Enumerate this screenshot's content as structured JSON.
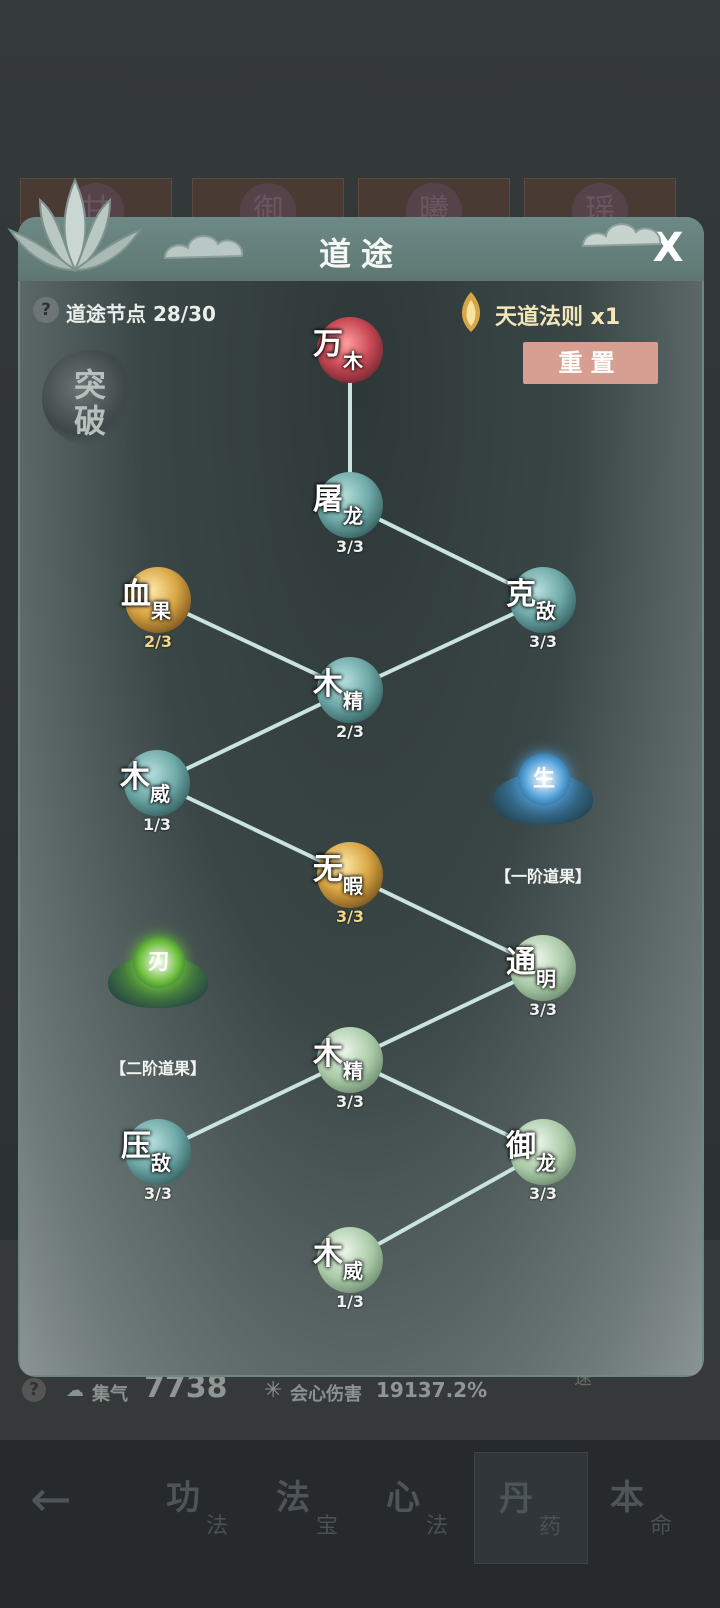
{
  "background": {
    "tiles": [
      "甘",
      "御",
      "曦",
      "瑶"
    ],
    "stats": {
      "qi_label": "集气",
      "qi_value": "7738",
      "crit_label": "会心伤害",
      "crit_value": "19137.2%",
      "side_badge": "速"
    }
  },
  "bottom_nav": [
    {
      "big": "功",
      "small": "法"
    },
    {
      "big": "法",
      "small": "宝"
    },
    {
      "big": "心",
      "small": "法"
    },
    {
      "big": "丹",
      "small": "药"
    },
    {
      "big": "本",
      "small": "命"
    }
  ],
  "modal": {
    "title": "道途",
    "close_label": "X",
    "path_nodes_label": "道途节点 28/30",
    "help_label": "?",
    "law_label": "天道法则 x1",
    "reset_label": "重置",
    "breakthrough": [
      "突",
      "破"
    ]
  },
  "nodes": [
    {
      "id": "wanmu",
      "c1": "万",
      "c2": "木",
      "level": "",
      "style": "red"
    },
    {
      "id": "tulong",
      "c1": "屠",
      "c2": "龙",
      "level": "3/3",
      "style": "teal"
    },
    {
      "id": "xueguo",
      "c1": "血",
      "c2": "果",
      "level": "2/3",
      "style": "gold"
    },
    {
      "id": "kedi",
      "c1": "克",
      "c2": "敌",
      "level": "3/3",
      "style": "teal"
    },
    {
      "id": "mujing1",
      "c1": "木",
      "c2": "精",
      "level": "2/3",
      "style": "teal"
    },
    {
      "id": "muwei1",
      "c1": "木",
      "c2": "威",
      "level": "1/3",
      "style": "teal"
    },
    {
      "id": "wuxia",
      "c1": "无",
      "c2": "暇",
      "level": "3/3",
      "style": "gold"
    },
    {
      "id": "tongming",
      "c1": "通",
      "c2": "明",
      "level": "3/3",
      "style": "pale"
    },
    {
      "id": "mujing2",
      "c1": "木",
      "c2": "精",
      "level": "3/3",
      "style": "pale"
    },
    {
      "id": "yadi",
      "c1": "压",
      "c2": "敌",
      "level": "3/3",
      "style": "teal"
    },
    {
      "id": "yulong",
      "c1": "御",
      "c2": "龙",
      "level": "3/3",
      "style": "pale"
    },
    {
      "id": "muwei2",
      "c1": "木",
      "c2": "威",
      "level": "1/3",
      "style": "pale"
    }
  ],
  "fruits": [
    {
      "id": "tier1",
      "core": "生",
      "label": "【一阶道果】",
      "color": "#4f9fd8"
    },
    {
      "id": "tier2",
      "core": "刃",
      "label": "【二阶道果】",
      "color": "#6cbf3a"
    }
  ]
}
